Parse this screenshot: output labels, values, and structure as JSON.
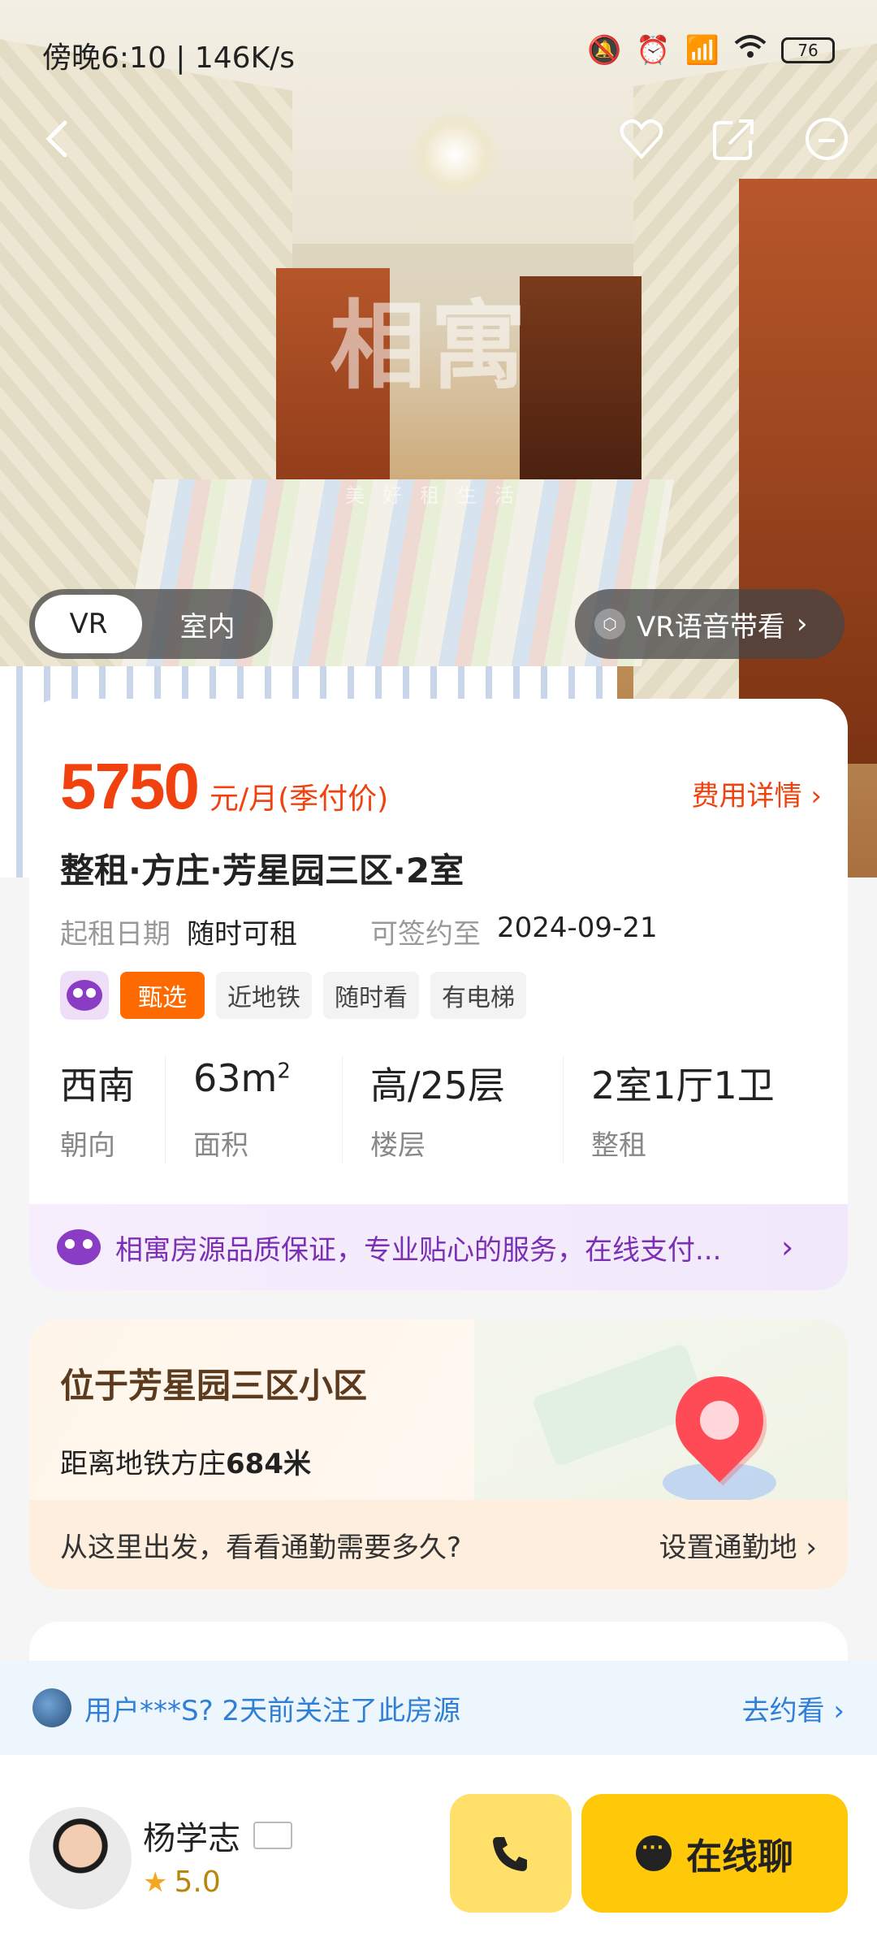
{
  "status_bar": {
    "time": "傍晚6:10 | 146K/s",
    "battery": "76"
  },
  "media": {
    "toggle_active": "VR",
    "toggle_inactive": "室内",
    "vr_guide": "VR语音带看",
    "watermark": "相寓",
    "watermark_sub": "美好租生活"
  },
  "listing": {
    "price": "5750",
    "price_unit": "元/月(季付价)",
    "fee_details": "费用详情 ›",
    "title": "整租·方庄·芳星园三区·2室",
    "start_label": "起租日期",
    "start_value": "随时可租",
    "sign_label": "可签约至",
    "sign_value": "2024-09-21",
    "tags": [
      "甄选",
      "近地铁",
      "随时看",
      "有电梯"
    ],
    "specs": [
      {
        "value": "西南",
        "label": "朝向"
      },
      {
        "value": "63m",
        "sup": "2",
        "label": "面积"
      },
      {
        "value": "高/25层",
        "label": "楼层"
      },
      {
        "value": "2室1厅1卫",
        "label": "整租"
      }
    ],
    "guarantee": "相寓房源品质保证，专业贴心的服务，在线支付..."
  },
  "location": {
    "title": "位于芳星园三区小区",
    "metro_prefix": "距离地铁方庄",
    "metro_distance": "684米",
    "commute_prompt": "从这里出发，看看通勤需要多久?",
    "commute_action": "设置通勤地 ›"
  },
  "follow": {
    "message": "用户***S? 2天前关注了此房源",
    "action": "去约看 ›"
  },
  "agent": {
    "name": "杨学志",
    "rating": "5.0"
  },
  "actions": {
    "chat": "在线聊"
  },
  "colors": {
    "price": "#f0410e",
    "tag_hot": "#ff6a00",
    "chat_button": "#ffc90a",
    "call_button": "#ffe06a",
    "follow_text": "#2f7fd6",
    "guarantee_text": "#7b2fb5"
  },
  "icons": {
    "back": "back-arrow-icon",
    "favorite": "heart-icon",
    "share": "share-icon",
    "message": "message-icon",
    "call": "phone-icon",
    "chat": "chat-bubble-icon",
    "vr": "cube-icon"
  }
}
